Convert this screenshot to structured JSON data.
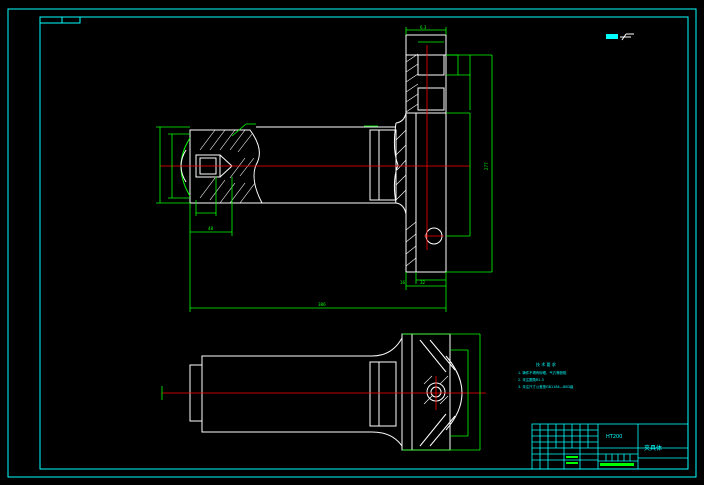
{
  "drawing": {
    "title_block": {
      "material": "HT200",
      "part_name": "夹具体"
    },
    "tech_requirements": {
      "heading": "技 术 要 求",
      "items": [
        "1. 铸件不得有砂眼、气孔等缺陷",
        "2. 未注圆角R2-3",
        "3. 未注尺寸公差按GB1184—80D级"
      ]
    },
    "dimensions": {
      "total_length": "386",
      "height_right": "277",
      "bore_depth": "48",
      "small_a": "32",
      "small_b": "16"
    },
    "surface_symbol": "6.3"
  },
  "colors": {
    "border": "#00ffff",
    "outline": "#ffffff",
    "dimension": "#00ff00",
    "centerline": "#ff0000",
    "text": "#00ffff"
  }
}
